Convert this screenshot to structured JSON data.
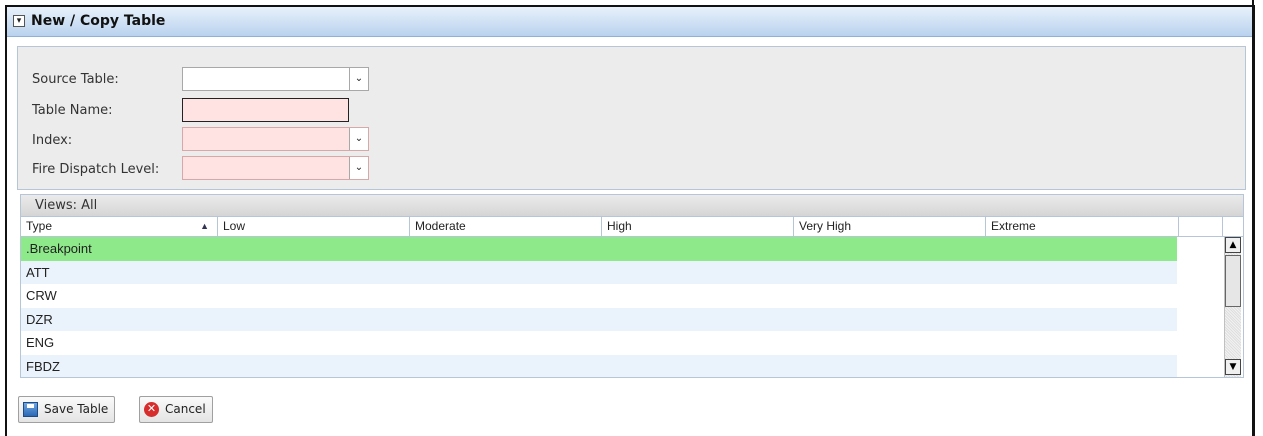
{
  "window": {
    "title": "New / Copy Table",
    "collapse_glyph": "▾"
  },
  "form": {
    "source_table": {
      "label": "Source Table:",
      "value": ""
    },
    "table_name": {
      "label": "Table Name:",
      "value": ""
    },
    "index": {
      "label": "Index:",
      "value": ""
    },
    "fire_dispatch_level": {
      "label": "Fire Dispatch Level:",
      "value": ""
    },
    "dropdown_glyph": "⌄"
  },
  "grid": {
    "views_label": "Views:  All",
    "columns": [
      "Type",
      "Low",
      "Moderate",
      "High",
      "Very High",
      "Extreme"
    ],
    "sort_indicator": "▲",
    "rows": [
      ".Breakpoint",
      "ATT",
      "CRW",
      "DZR",
      "ENG",
      "FBDZ"
    ],
    "selected_row_color": "#8ee98a",
    "alt_row_color": "#eaf3fb"
  },
  "scrollbar": {
    "up_glyph": "▲",
    "down_glyph": "▼"
  },
  "buttons": {
    "save": "Save Table",
    "cancel": "Cancel",
    "cancel_icon_glyph": "✕"
  }
}
